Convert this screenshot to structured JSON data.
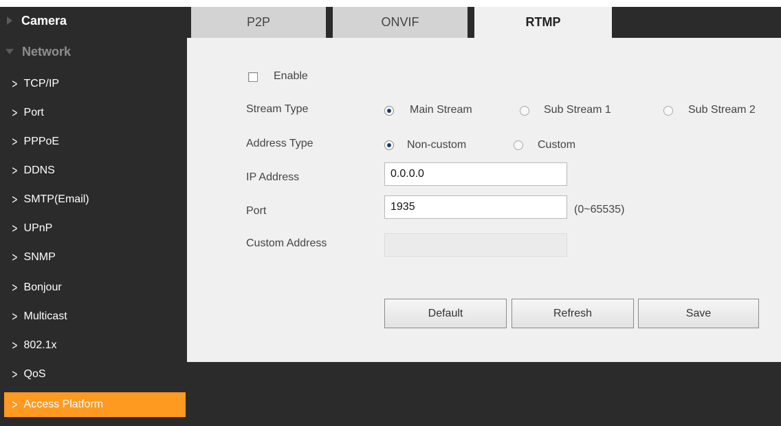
{
  "sidebar": {
    "sections": [
      {
        "label": "Camera",
        "state": "collapsed"
      },
      {
        "label": "Network",
        "state": "expanded"
      }
    ],
    "items": [
      {
        "label": "TCP/IP"
      },
      {
        "label": "Port"
      },
      {
        "label": "PPPoE"
      },
      {
        "label": "DDNS"
      },
      {
        "label": "SMTP(Email)"
      },
      {
        "label": "UPnP"
      },
      {
        "label": "SNMP"
      },
      {
        "label": "Bonjour"
      },
      {
        "label": "Multicast"
      },
      {
        "label": "802.1x"
      },
      {
        "label": "QoS"
      },
      {
        "label": "Access Platform",
        "active": true
      }
    ],
    "item_icon": ">"
  },
  "tabs": [
    {
      "label": "P2P",
      "active": false
    },
    {
      "label": "ONVIF",
      "active": false
    },
    {
      "label": "RTMP",
      "active": true
    }
  ],
  "form": {
    "enable_label": "Enable",
    "enable_checked": false,
    "stream_type": {
      "label": "Stream Type",
      "options": [
        "Main Stream",
        "Sub Stream 1",
        "Sub Stream 2"
      ],
      "selected": "Main Stream"
    },
    "address_type": {
      "label": "Address Type",
      "options": [
        "Non-custom",
        "Custom"
      ],
      "selected": "Non-custom"
    },
    "ip_address": {
      "label": "IP Address",
      "value": "0.0.0.0"
    },
    "port": {
      "label": "Port",
      "value": "1935",
      "hint": "(0~65535)"
    },
    "custom_address": {
      "label": "Custom Address",
      "value": "",
      "disabled": true
    }
  },
  "buttons": {
    "default": "Default",
    "refresh": "Refresh",
    "save": "Save"
  },
  "colors": {
    "sidebar_bg": "#2b2b2b",
    "active_item": "#ff9a21",
    "panel_bg": "#f0f0f0",
    "tab_inactive": "#d3d3d3"
  }
}
